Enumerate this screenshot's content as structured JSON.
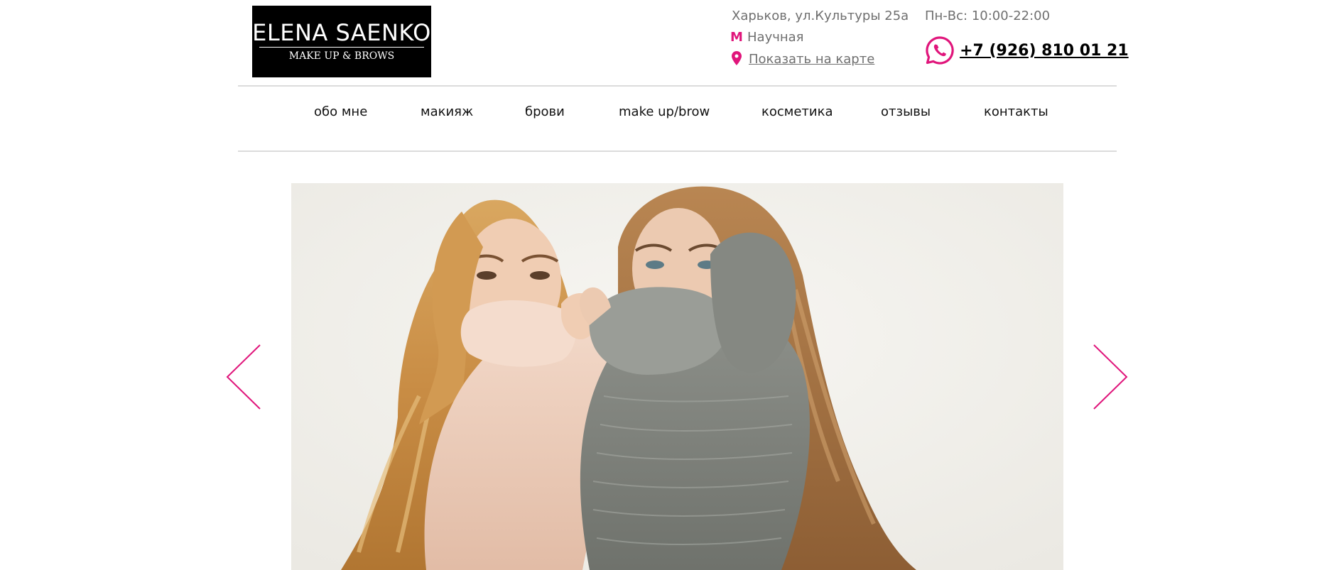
{
  "brand": {
    "name": "ELENA SAENKO",
    "tagline": "MAKE UP & BROWS"
  },
  "contacts": {
    "address": "Харьков, ул.Культуры 25а",
    "metro_icon": "М",
    "metro": "Научная",
    "map_icon": "map-pin-icon",
    "map_link": "Показать на карте",
    "hours": "Пн-Вс: 10:00-22:00",
    "phone_icon": "whatsapp-icon",
    "phone": "+7 (926) 810 01 21"
  },
  "nav": {
    "items": [
      {
        "label": "обо мне"
      },
      {
        "label": "макияж"
      },
      {
        "label": "брови"
      },
      {
        "label": "make up/brow"
      },
      {
        "label": "косметика"
      },
      {
        "label": "отзывы"
      },
      {
        "label": "контакты"
      }
    ]
  },
  "slider": {
    "prev_icon": "chevron-left-icon",
    "next_icon": "chevron-right-icon"
  },
  "colors": {
    "accent": "#e0157b",
    "text_muted": "#6f6f6f",
    "divider": "#dcdcdc"
  }
}
